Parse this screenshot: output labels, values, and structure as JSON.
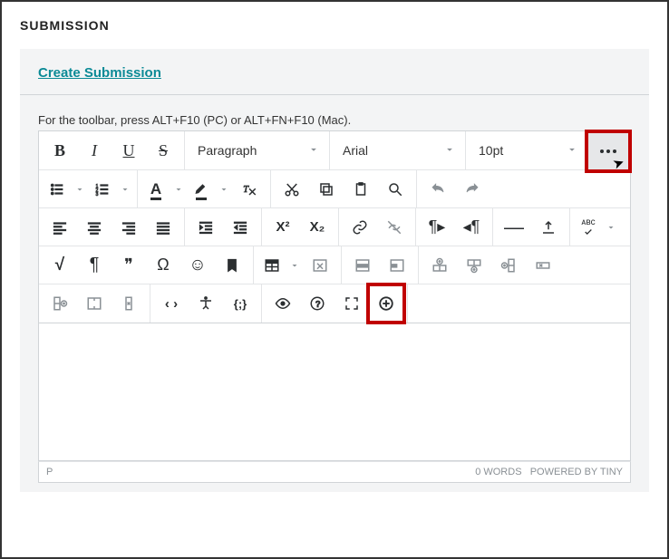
{
  "page": {
    "title": "SUBMISSION"
  },
  "panel": {
    "create_link": "Create Submission"
  },
  "editor": {
    "hint": "For the toolbar, press ALT+F10 (PC) or ALT+FN+F10 (Mac).",
    "block_format": "Paragraph",
    "font_family": "Arial",
    "font_size": "10pt"
  },
  "status": {
    "path": "P",
    "words": "0 WORDS",
    "powered": "POWERED BY TINY"
  },
  "glyph": {
    "bold": "B",
    "italic": "I",
    "underline": "U",
    "strike": "S",
    "text_color": "A",
    "sup": "X²",
    "sub": "X₂",
    "ltr": "¶",
    "math": "√",
    "pilcrow": "¶",
    "quotes": "❞",
    "omega": "Ω",
    "emoji": "☺",
    "bookmark_fill": "🔖",
    "codesample": "‹ ›",
    "braces": "{;}",
    "help": "?",
    "spellcheck": "ᴀʙᴄ",
    "hr": "—"
  }
}
